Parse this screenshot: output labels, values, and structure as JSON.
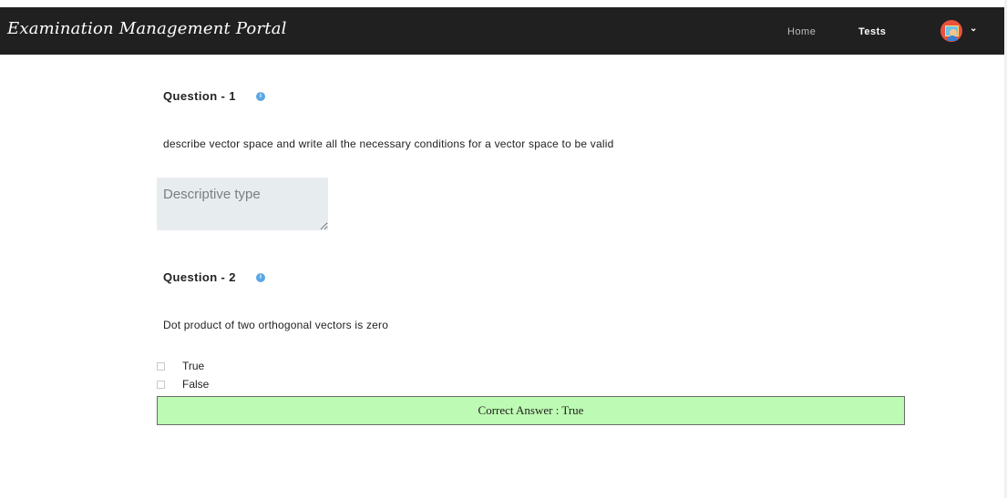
{
  "header": {
    "brand": "Examination Management Portal",
    "nav": {
      "home": "Home",
      "tests": "Tests"
    },
    "avatar_icon": "user-avatar",
    "dropdown_icon": "chevron-down-icon"
  },
  "questions": [
    {
      "title": "Question - 1",
      "text": "describe vector space and write all the necessary conditions for a vector space to be valid",
      "answer_placeholder": "Descriptive type"
    },
    {
      "title": "Question - 2",
      "text": "Dot product of two orthogonal vectors is zero",
      "options": [
        "True",
        "False"
      ],
      "correct_answer": "Correct Answer : True"
    }
  ],
  "colors": {
    "header_bg": "#202020",
    "info_icon": "#5aa7e6",
    "correct_bg": "#bdfab3",
    "textarea_bg": "#e7ecef"
  }
}
